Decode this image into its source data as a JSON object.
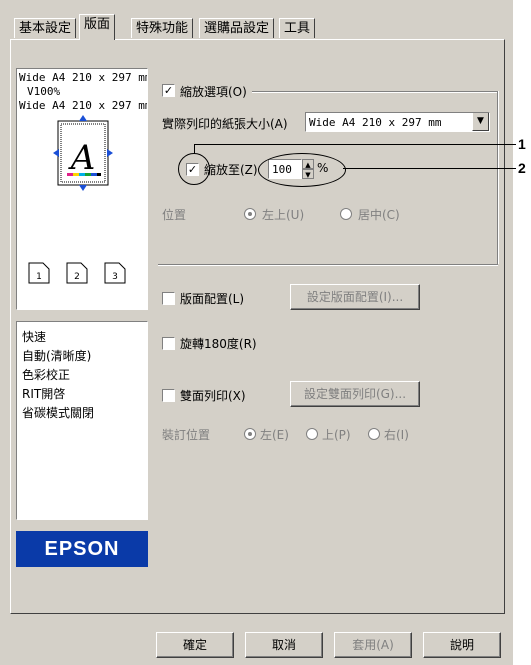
{
  "tabs": [
    "基本設定",
    "版面",
    "特殊功能",
    "選購品設定",
    "工具"
  ],
  "preview": {
    "lines": [
      "Wide A4 210 x 297 mm",
      "V100%",
      "Wide A4 210 x 297 mm"
    ],
    "page_letter": "A",
    "pages": [
      "1",
      "2",
      "3"
    ]
  },
  "settings_list": [
    "快速",
    "自動(清晰度)",
    "色彩校正",
    "RIT開啓",
    "省碳模式關閉"
  ],
  "brand": "EPSON",
  "zoom_options": {
    "label": "縮放選項(O)",
    "checked": true,
    "paper_size_label": "實際列印的紙張大小(A)",
    "paper_size_value": "Wide A4 210 x 297 mm",
    "zoom_to_label": "縮放至(Z)",
    "zoom_to_checked": true,
    "zoom_value": "100",
    "percent": "%",
    "position_label": "位置",
    "position_top_left": "左上(U)",
    "position_center": "居中(C)"
  },
  "layout": {
    "label": "版面配置(L)",
    "button": "設定版面配置(I)..."
  },
  "rotate": {
    "label": "旋轉180度(R)"
  },
  "duplex": {
    "label": "雙面列印(X)",
    "button": "設定雙面列印(G)...",
    "binding_label": "裝訂位置",
    "left": "左(E)",
    "top": "上(P)",
    "right": "右(I)"
  },
  "footer": {
    "ok": "確定",
    "cancel": "取消",
    "apply": "套用(A)",
    "help": "說明"
  },
  "callouts": [
    "1",
    "2"
  ],
  "colors": {
    "dialog_bg": "#d4d0c8",
    "epson_blue": "#0a3aa8"
  }
}
